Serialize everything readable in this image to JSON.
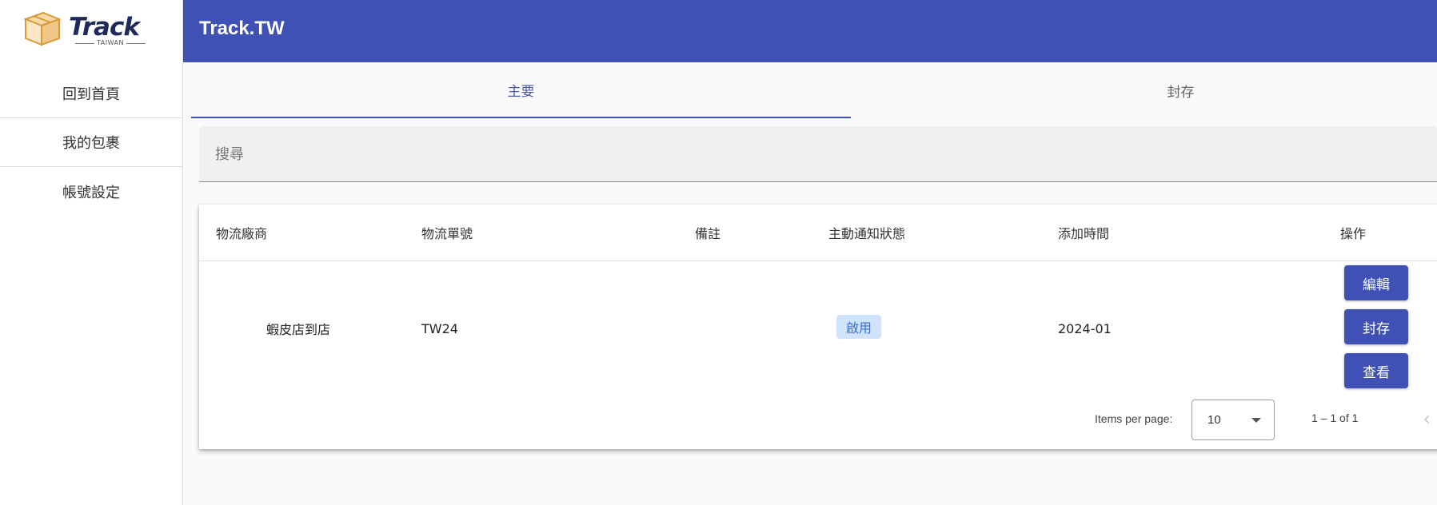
{
  "brand": {
    "logo_word": "Track",
    "logo_sub": "TAIWAN"
  },
  "header": {
    "title": "Track.TW"
  },
  "sidebar": {
    "items": [
      {
        "label": "回到首頁"
      },
      {
        "label": "我的包裹"
      },
      {
        "label": "帳號設定"
      }
    ]
  },
  "tabs": [
    {
      "label": "主要",
      "active": true
    },
    {
      "label": "封存",
      "active": false
    }
  ],
  "search": {
    "placeholder": "搜尋",
    "value": ""
  },
  "table": {
    "columns": [
      "物流廠商",
      "物流單號",
      "備註",
      "主動通知狀態",
      "添加時間",
      "操作"
    ],
    "rows": [
      {
        "carrier": "蝦皮店到店",
        "tracking_no": "TW24",
        "note": "",
        "notify_status": "啟用",
        "added_time": "2024-01",
        "actions": [
          "編輯",
          "封存",
          "查看"
        ]
      }
    ]
  },
  "paginator": {
    "items_per_page_label": "Items per page:",
    "page_size": "10",
    "range_label": "1 – 1 of 1"
  },
  "colors": {
    "primary": "#3f51b5",
    "chip_bg": "#cfe3fb",
    "chip_text": "#3a6fd8"
  }
}
